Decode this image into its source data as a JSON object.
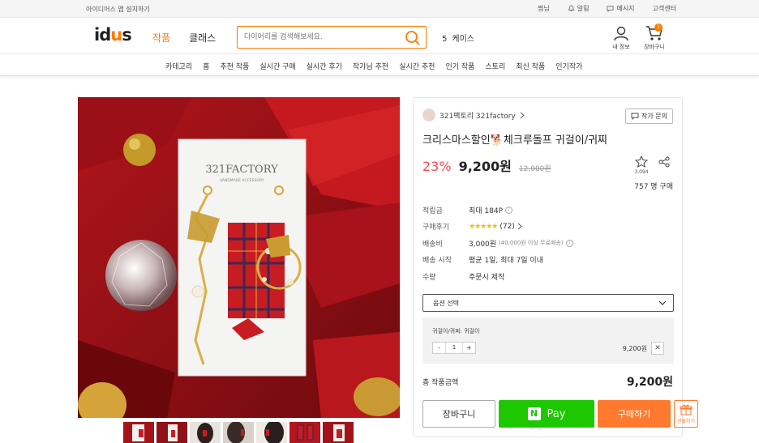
{
  "topbar": {
    "install_app": "아이디어스 앱 설치하기",
    "links": [
      "찜님",
      "알림",
      "메시지",
      "고객센터"
    ]
  },
  "header": {
    "logo_left": "id",
    "logo_mid": "u",
    "logo_right": "s",
    "nav": [
      "작품",
      "클래스"
    ],
    "search_placeholder": "다이어리를 검색해보세요.",
    "trending_rank": "5",
    "trending_term": "케이스",
    "user_label": "내 정보",
    "cart_label": "장바구니",
    "cart_count": "1"
  },
  "catnav": [
    "카테고리",
    "홈",
    "추천 작품",
    "실시간 구매",
    "실시간 후기",
    "작가님 추천",
    "실시간 추천",
    "인기 작품",
    "스토리",
    "최신 작품",
    "인기작가"
  ],
  "product": {
    "seller": "321팩토리 321factory",
    "ask_label": "작가 문의",
    "title": "크리스마스할인🐕체크루돌프 귀걸이/귀찌",
    "discount": "23%",
    "price": "9,200원",
    "original_price": "12,000원",
    "favorites": "3,094",
    "buyers": "757 명 구매",
    "card_brand": "321FACTORY",
    "card_sub": "HANDMADE ACCESSORY"
  },
  "info": {
    "points_label": "적립금",
    "points_value": "최대 184P",
    "reviews_label": "구매후기",
    "reviews_stars": "★★★★★",
    "reviews_count": "(72)",
    "shipping_label": "배송비",
    "shipping_value": "3,000원",
    "shipping_note": "(40,000원 이상 무료배송)",
    "start_label": "배송 시작",
    "start_value": "평균 1일, 최대 7일 이내",
    "qty_label": "수량",
    "qty_value": "주문시 제작"
  },
  "option": {
    "select_label": "옵션 선택",
    "selected_name": "귀걸이/귀찌: 귀걸이",
    "minus": "-",
    "qty": "1",
    "plus": "+",
    "selected_price": "9,200원",
    "remove": "✕"
  },
  "total": {
    "label": "총 작품금액",
    "amount": "9,200원"
  },
  "buttons": {
    "cart": "장바구니",
    "npay_n": "N",
    "npay": "Pay",
    "buy": "구매하기",
    "gift": "선물하기"
  },
  "colors": {
    "brand": "#ff7a00",
    "discount": "#ff4b50",
    "npay": "#1ec800",
    "buy": "#ff7a2e"
  }
}
